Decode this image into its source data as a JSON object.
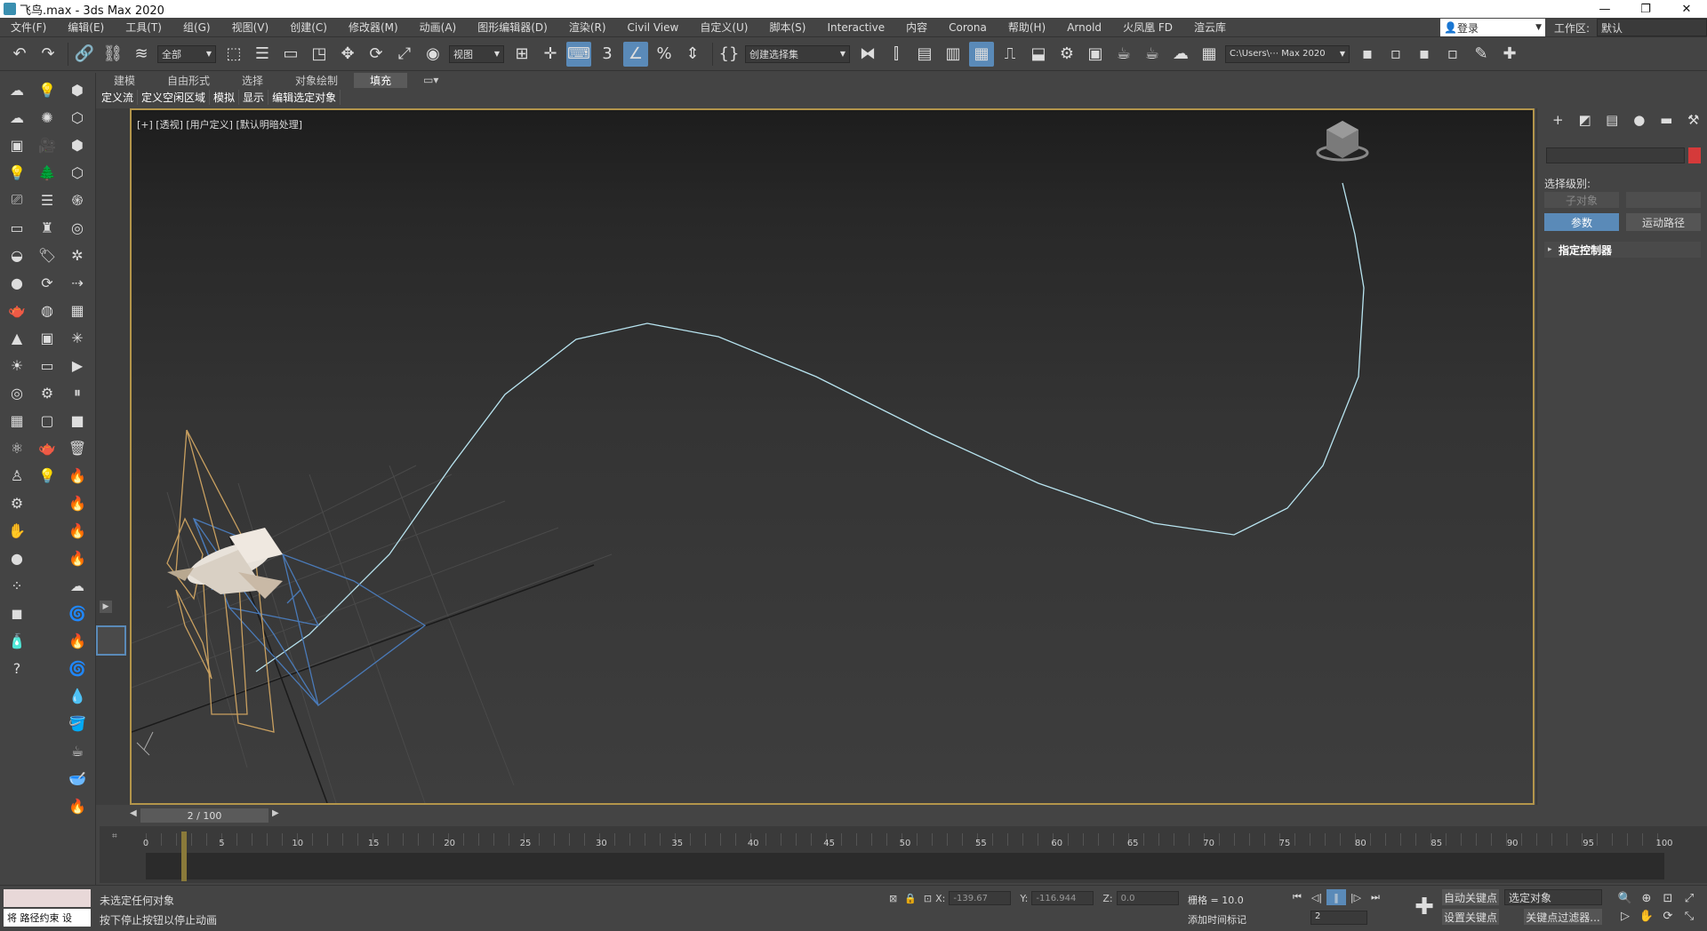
{
  "window": {
    "title": "飞鸟.max - 3ds Max 2020"
  },
  "menu": [
    "文件(F)",
    "编辑(E)",
    "工具(T)",
    "组(G)",
    "视图(V)",
    "创建(C)",
    "修改器(M)",
    "动画(A)",
    "图形编辑器(D)",
    "渲染(R)",
    "Civil View",
    "自定义(U)",
    "脚本(S)",
    "Interactive",
    "内容",
    "Corona",
    "帮助(H)",
    "Arnold",
    "火凤凰 FD",
    "渲云库"
  ],
  "login": {
    "label": "登录"
  },
  "workspace": {
    "label": "工作区:",
    "value": "默认"
  },
  "toolbar": {
    "filter": "全部",
    "refcoord": "视图",
    "namedsel": "创建选择集",
    "path": "C:\\Users\\⋯ Max 2020"
  },
  "ribbon": {
    "tabs": [
      "建模",
      "自由形式",
      "选择",
      "对象绘制",
      "填充"
    ],
    "active_tab": 4,
    "subtools": [
      "定义流",
      "定义空闲区域",
      "模拟",
      "显示",
      "编辑选定对象"
    ]
  },
  "viewport": {
    "label": "[+] [透视] [用户定义] [默认明暗处理]"
  },
  "command_panel": {
    "selection_level": "选择级别:",
    "sub_object": "子对象",
    "params": "参数",
    "motion_path": "运动路径",
    "rollout": "指定控制器"
  },
  "frame_slider": {
    "value": "2 / 100"
  },
  "timeline": {
    "labels": [
      "0",
      "5",
      "10",
      "15",
      "20",
      "25",
      "30",
      "35",
      "40",
      "45",
      "50",
      "55",
      "60",
      "65",
      "70",
      "75",
      "80",
      "85",
      "90",
      "95",
      "100"
    ]
  },
  "status": {
    "maxscript": "将 路径约束 设",
    "line1": "未选定任何对象",
    "line2": "按下停止按钮以停止动画",
    "x_label": "X:",
    "x": "-139.67",
    "y_label": "Y:",
    "y": "-116.944",
    "z_label": "Z:",
    "z": "0.0",
    "grid": "栅格 = 10.0",
    "add_time_tag": "添加时间标记",
    "frame": "2",
    "auto_key": "自动关键点",
    "set_key": "设置关键点",
    "selected_object": "选定对象",
    "key_filters": "关键点过滤器..."
  }
}
